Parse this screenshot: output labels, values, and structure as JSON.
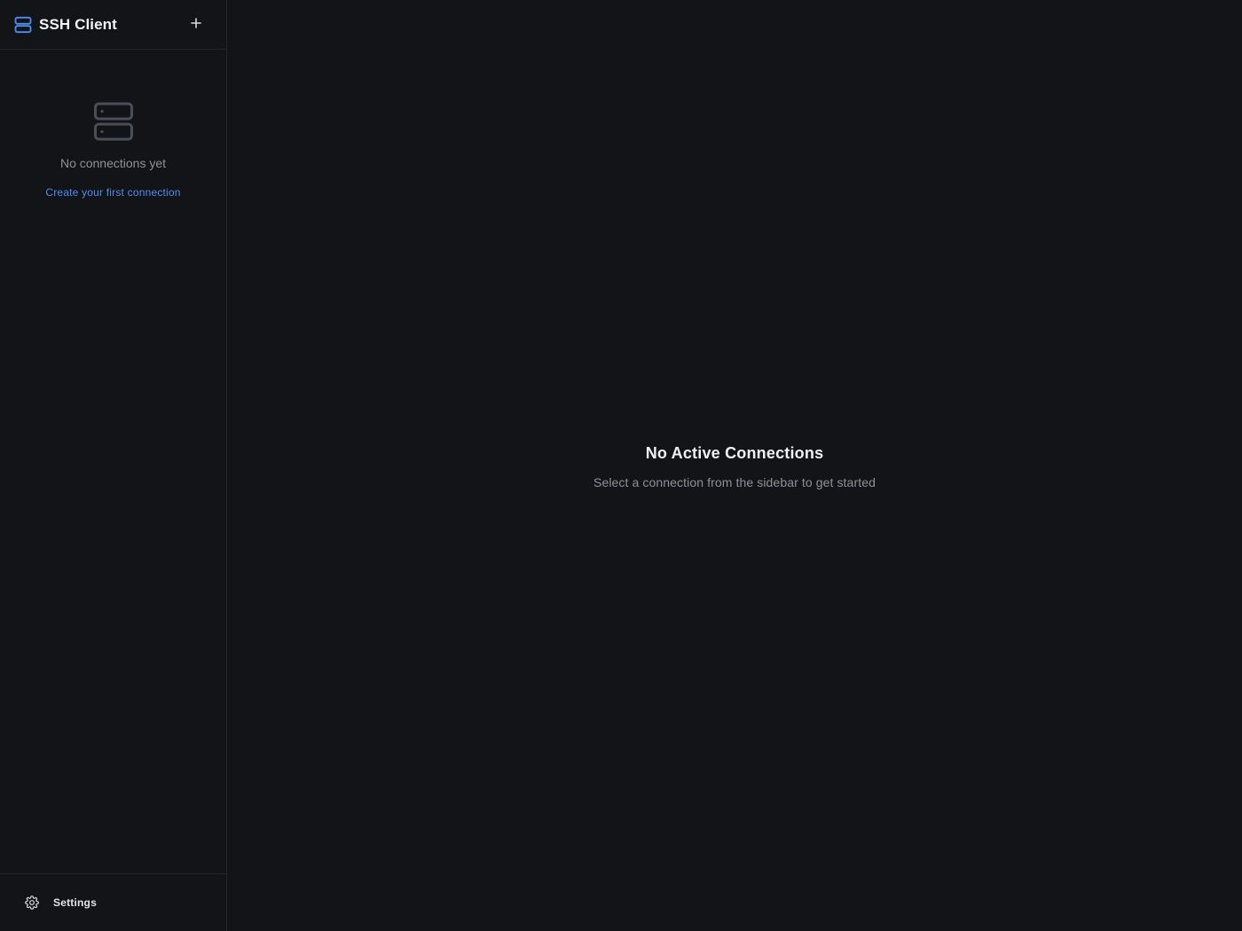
{
  "app": {
    "title": "SSH Client",
    "accent_color": "#4d8ef0"
  },
  "sidebar": {
    "header_icon": "server-icon",
    "add_icon": "plus-icon",
    "empty_state": {
      "icon": "server-stack-icon",
      "message": "No connections yet",
      "link_label": "Create your first connection"
    },
    "footer": {
      "settings_icon": "gear-icon",
      "settings_label": "Settings"
    }
  },
  "main": {
    "title": "No Active Connections",
    "subtitle": "Select a connection from the sidebar to get started"
  }
}
